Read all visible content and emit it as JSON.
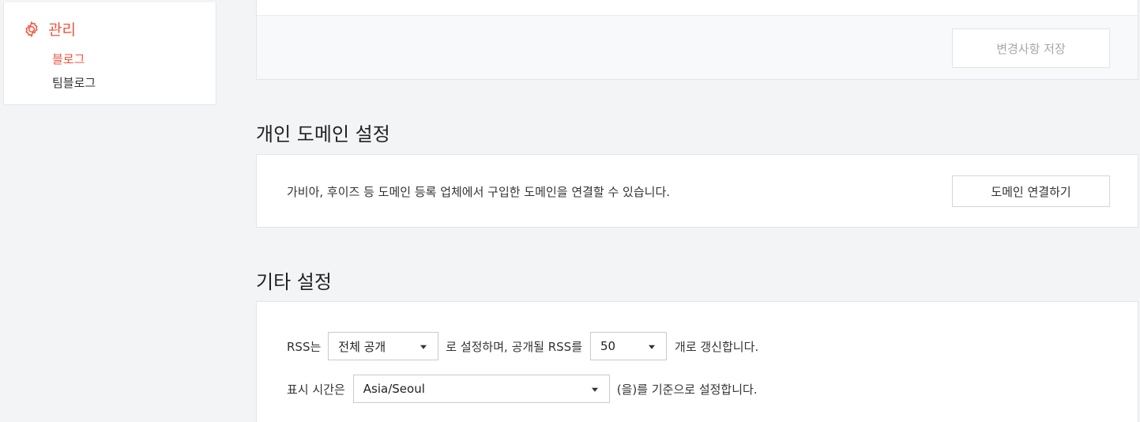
{
  "sidebar": {
    "section_title": "관리",
    "icon": "gear-icon",
    "items": [
      {
        "label": "블로그",
        "active": true
      },
      {
        "label": "팀블로그",
        "active": false
      }
    ]
  },
  "top_card": {
    "save_button": "변경사항 저장"
  },
  "domain_section": {
    "title": "개인 도메인 설정",
    "description": "가비아, 후이즈 등 도메인 등록 업체에서 구입한 도메인을 연결할 수 있습니다.",
    "connect_button": "도메인 연결하기"
  },
  "etc_section": {
    "title": "기타 설정",
    "rss": {
      "prefix": "RSS는",
      "visibility_value": "전체 공개",
      "middle": "로 설정하며, 공개될 RSS를",
      "count_value": "50",
      "suffix": "개로 갱신합니다."
    },
    "timezone": {
      "prefix": "표시 시간은",
      "value": "Asia/Seoul",
      "suffix": "(을)를 기준으로 설정합니다."
    }
  },
  "colors": {
    "accent": "#f0533d",
    "background": "#f3f4f6",
    "border": "#e4e5e8"
  }
}
